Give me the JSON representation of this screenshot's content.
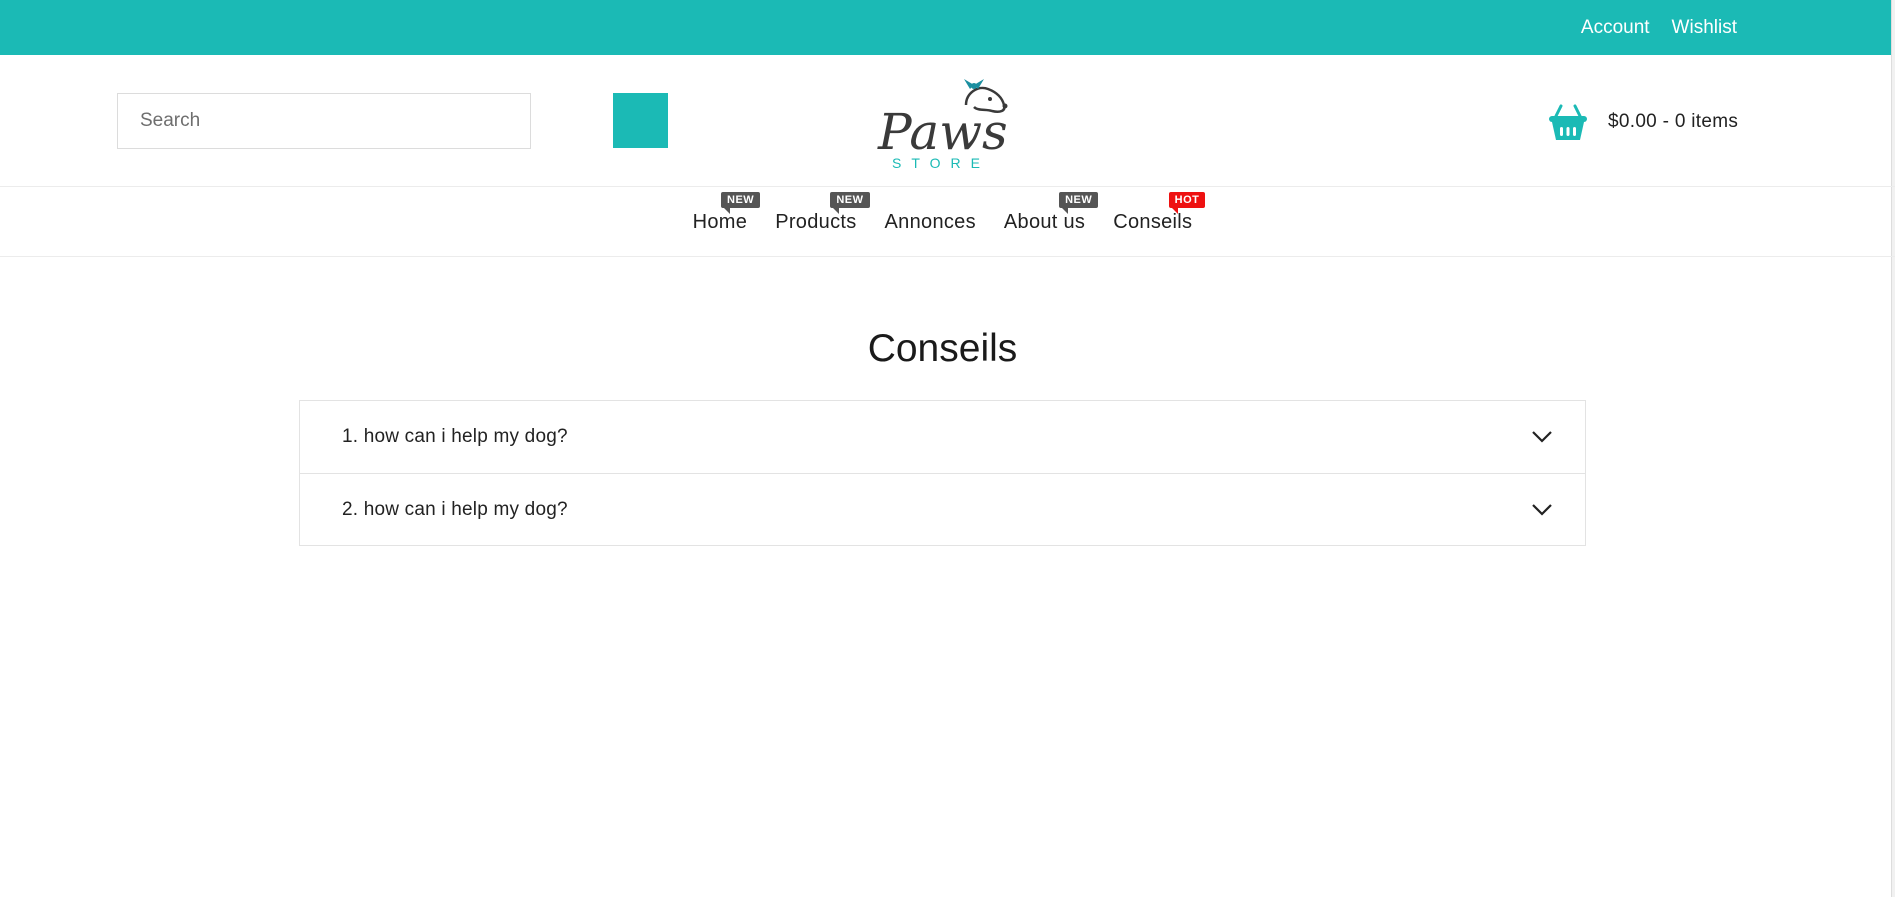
{
  "topbar": {
    "account": "Account",
    "wishlist": "Wishlist",
    "bg_color": "#1bbab5"
  },
  "header": {
    "search": {
      "placeholder": "Search",
      "value": ""
    },
    "search_button_icon": "search-icon",
    "logo": {
      "word": "Paws",
      "sub": "STORE"
    },
    "cart": {
      "icon": "basket-icon",
      "summary": "$0.00 - 0 items"
    }
  },
  "nav": {
    "items": [
      {
        "label": "Home",
        "badge": "NEW"
      },
      {
        "label": "Products",
        "badge": "NEW"
      },
      {
        "label": "Annonces",
        "badge": ""
      },
      {
        "label": "About us",
        "badge": "NEW"
      },
      {
        "label": "Conseils",
        "badge": "HOT"
      }
    ]
  },
  "page": {
    "title": "Conseils",
    "faq": [
      {
        "question": "1. how can i help my dog?",
        "icon": "chevron-down-icon"
      },
      {
        "question": "2. how can i help my dog?",
        "icon": "chevron-down-icon"
      }
    ]
  },
  "colors": {
    "accent": "#1bbab5",
    "badge_new": "#555555",
    "badge_hot": "#ee1111"
  }
}
